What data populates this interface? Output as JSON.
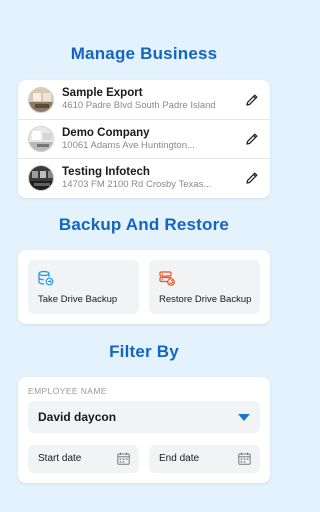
{
  "manage": {
    "title": "Manage Business",
    "businesses": [
      {
        "name": "Sample Export",
        "address": "4610 Padre Blvd South Padre Island",
        "avatar_icon": "office-photo-icon"
      },
      {
        "name": "Demo Company",
        "address": "10061 Adams Ave Huntington...",
        "avatar_icon": "office-photo-icon"
      },
      {
        "name": "Testing Infotech",
        "address": "14703 FM 2100 Rd Crosby Texas...",
        "avatar_icon": "office-photo-icon"
      }
    ],
    "edit_icon": "pencil-icon"
  },
  "backup": {
    "title": "Backup And Restore",
    "take_label": "Take Drive Backup",
    "restore_label": "Restore Drive Backup",
    "take_icon": "database-backup-icon",
    "restore_icon": "database-restore-icon"
  },
  "filter": {
    "title": "Filter By",
    "employee_label": "EMPLOYEE NAME",
    "employee_value": "David daycon",
    "start_date_placeholder": "Start date",
    "end_date_placeholder": "End date",
    "calendar_icon": "calendar-icon"
  },
  "colors": {
    "background": "#e3f2fd",
    "accent": "#1565c0",
    "caret": "#1976d2",
    "take_icon": "#2196f3",
    "restore_icon": "#f4511e"
  }
}
